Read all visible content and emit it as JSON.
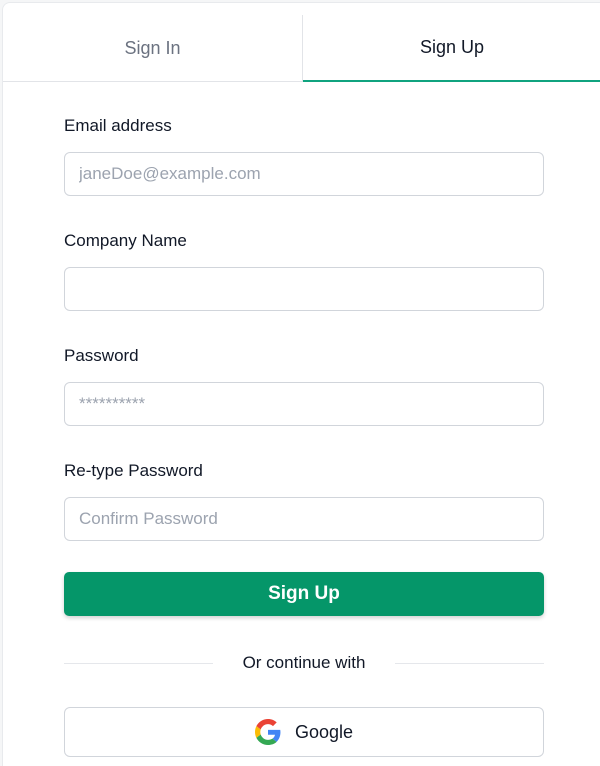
{
  "tabs": {
    "sign_in": "Sign In",
    "sign_up": "Sign Up",
    "active": "sign_up"
  },
  "form": {
    "email": {
      "label": "Email address",
      "placeholder": "janeDoe@example.com",
      "value": ""
    },
    "company": {
      "label": "Company Name",
      "placeholder": "",
      "value": ""
    },
    "password": {
      "label": "Password",
      "placeholder": "**********",
      "value": ""
    },
    "retype_password": {
      "label": "Re-type Password",
      "placeholder": "Confirm Password",
      "value": ""
    },
    "submit_label": "Sign Up"
  },
  "divider_text": "Or continue with",
  "social": {
    "google_label": "Google",
    "google_icon": "google-icon"
  },
  "colors": {
    "accent": "#10a37f",
    "primary_button": "#059669"
  }
}
